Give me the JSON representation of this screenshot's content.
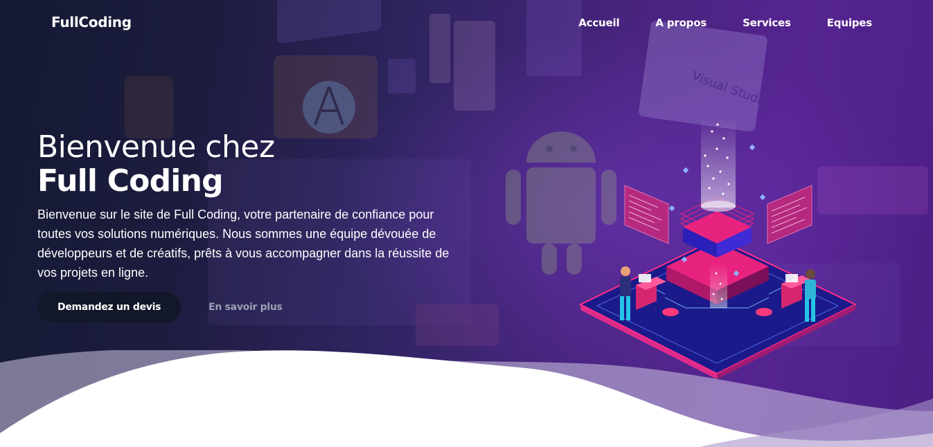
{
  "navbar": {
    "brand": "FullCoding",
    "links": [
      {
        "label": "Accueil"
      },
      {
        "label": "A propos"
      },
      {
        "label": "Services"
      },
      {
        "label": "Equipes"
      }
    ]
  },
  "hero": {
    "title_line1": "Bienvenue chez",
    "title_line2": "Full Coding",
    "description": "Bienvenue sur le site de Full Coding, votre partenaire de confiance pour toutes vos solutions numériques. Nous sommes une équipe dévouée de développeurs et de créatifs, prêts à vous accompagner dans la réussite de vos projets en ligne.",
    "primary_cta": "Demandez un devis",
    "secondary_cta": "En savoir plus",
    "illustration_sign": "Visual Studio"
  },
  "colors": {
    "accent_pink": "#e8237f",
    "accent_blue": "#2a1fb8",
    "primary_button": "#121729",
    "secondary_text": "#9aa0b4"
  }
}
